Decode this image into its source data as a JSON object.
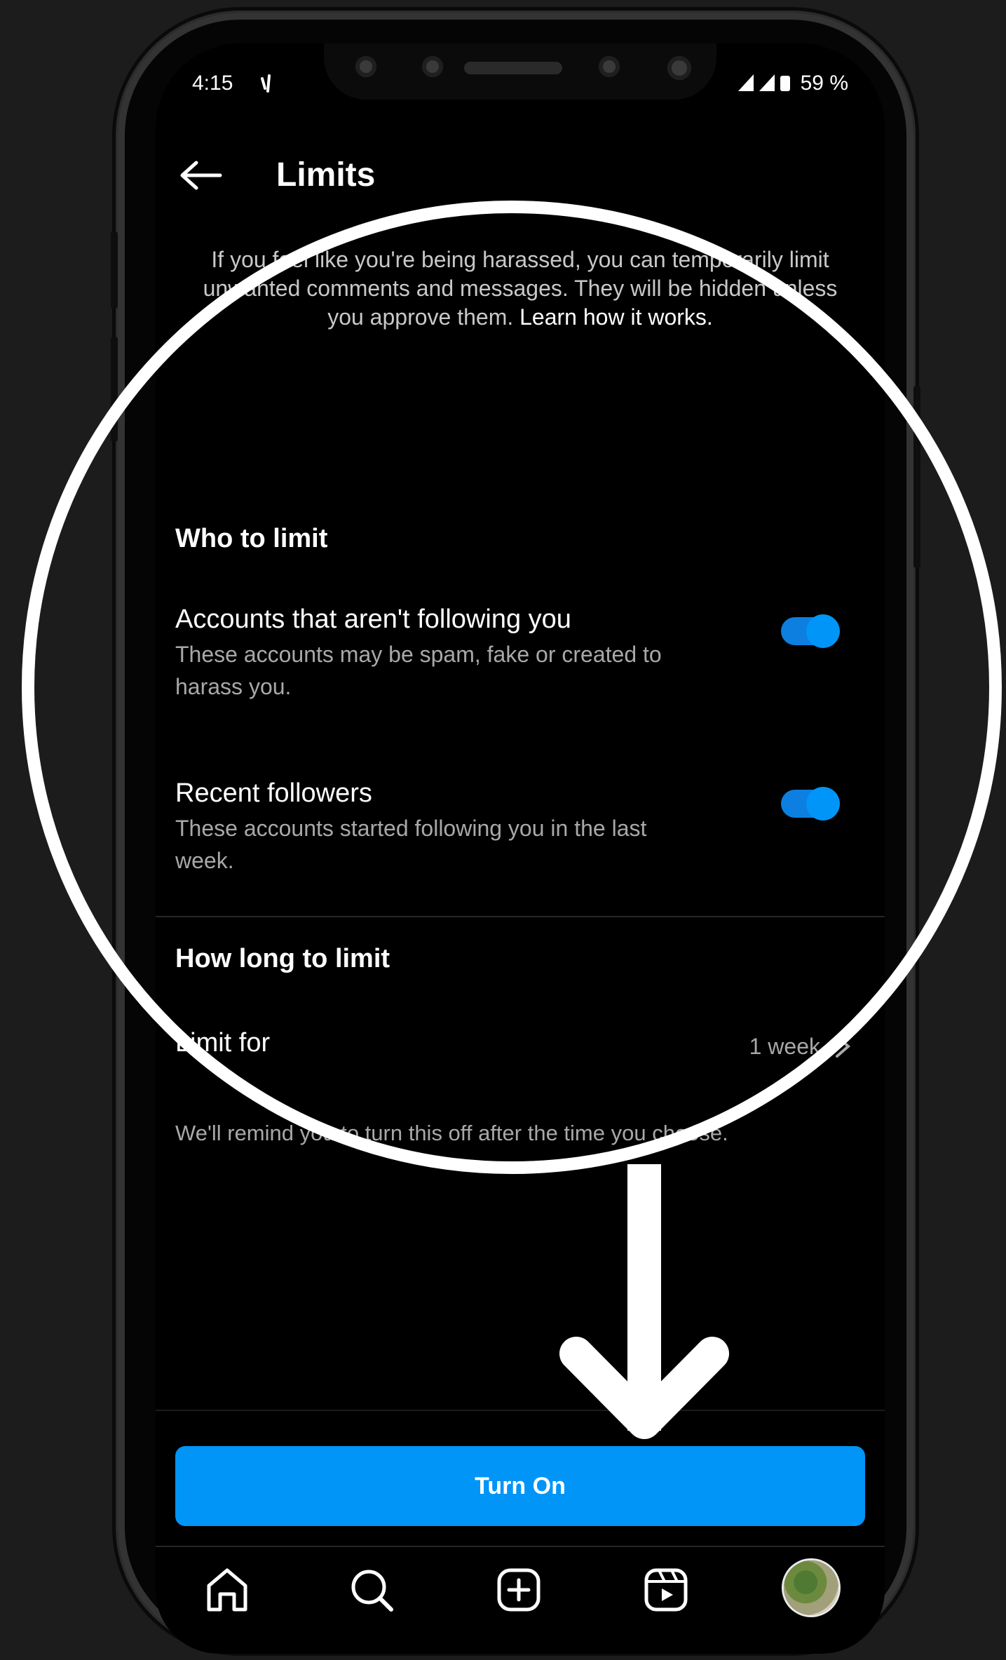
{
  "status_bar": {
    "time": "4:15",
    "battery": "59 %"
  },
  "header": {
    "title": "Limits"
  },
  "intro": {
    "text": "If you feel like you're being harassed, you can temporarily limit unwanted comments and messages. They will be hidden unless you approve them.",
    "link": "Learn how it works."
  },
  "who_to_limit": {
    "heading": "Who to limit",
    "items": [
      {
        "title": "Accounts that aren't following you",
        "subtitle": "These accounts may be spam, fake or created to harass you.",
        "enabled": true
      },
      {
        "title": "Recent followers",
        "subtitle": "These accounts started following you in the last week.",
        "enabled": true
      }
    ]
  },
  "how_long": {
    "heading": "How long to limit",
    "label": "Limit for",
    "value": "1 week",
    "reminder": "We'll remind you to turn this off after the time you choose."
  },
  "cta": {
    "label": "Turn On"
  },
  "nav": [
    "home-icon",
    "search-icon",
    "create-icon",
    "reels-icon",
    "profile-avatar"
  ],
  "colors": {
    "accent": "#0095f6",
    "background": "#000000"
  }
}
